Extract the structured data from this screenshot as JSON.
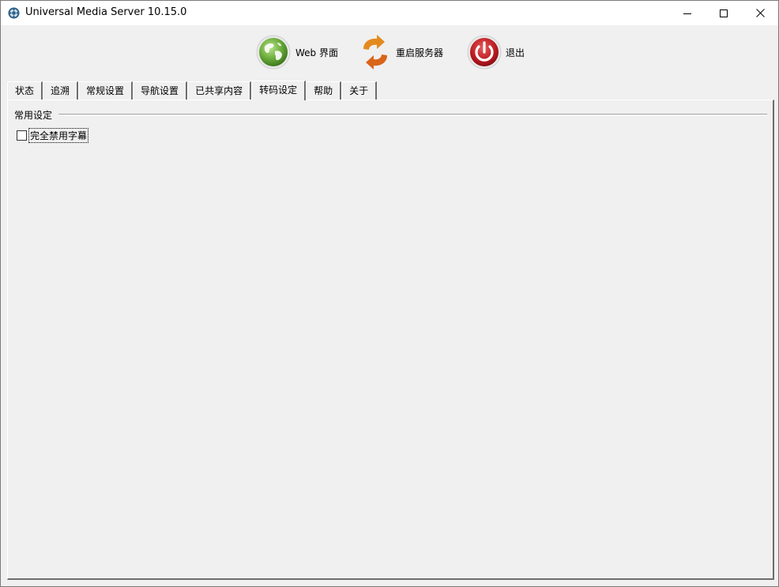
{
  "window": {
    "title": "Universal Media Server 10.15.0"
  },
  "toolbar": {
    "web_label": "Web 界面",
    "restart_label": "重启服务器",
    "quit_label": "退出"
  },
  "tabs": [
    {
      "label": "状态"
    },
    {
      "label": "追溯"
    },
    {
      "label": "常规设置"
    },
    {
      "label": "导航设置"
    },
    {
      "label": "已共享内容"
    },
    {
      "label": "转码设定",
      "active": true
    },
    {
      "label": "帮助"
    },
    {
      "label": "关于"
    }
  ],
  "panel": {
    "group_title": "常用设定",
    "disable_subtitles_label": "完全禁用字幕",
    "disable_subtitles_checked": false
  },
  "icons": {
    "app": "ums-app-icon",
    "web": "globe-icon",
    "restart": "restart-arrows-icon",
    "quit": "power-icon"
  },
  "colors": {
    "globe_green": "#6aab3a",
    "restart_orange": "#e37a1f",
    "power_red": "#b8191f"
  }
}
